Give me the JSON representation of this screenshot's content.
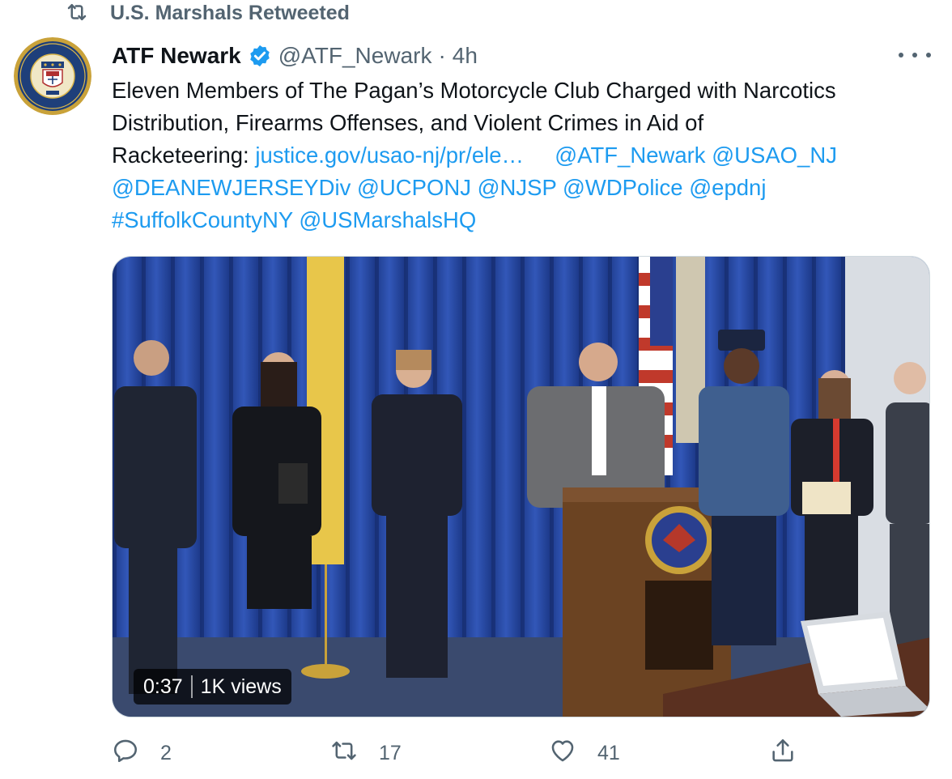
{
  "retweet_context": {
    "label": "U.S. Marshals Retweeted",
    "icon": "retweet-icon"
  },
  "author": {
    "name": "ATF Newark",
    "verified_icon": "verified-badge-icon",
    "handle": "@ATF_Newark",
    "separator": "·",
    "time": "4h",
    "avatar_icon": "atf-seal-avatar"
  },
  "more_icon": "more-options-icon",
  "tweet": {
    "line1": "Eleven Members of The Pagan’s Motorcycle Club Charged with Narcotics",
    "line2": "Distribution, Firearms Offenses, and Violent Crimes in Aid of",
    "line3_prefix": "Racketeering: ",
    "line3_link": "justice.gov/usao-nj/pr/ele…",
    "line3_mentions": [
      "@ATF_Newark",
      "@USAO_NJ"
    ],
    "line4_mentions": [
      "@DEANEWJERSEYDiv",
      "@UCPONJ",
      "@NJSP",
      "@WDPolice",
      "@epdnj"
    ],
    "line5_tags": [
      "#SuffolkCountyNY",
      "@USMarshalsHQ"
    ]
  },
  "video": {
    "duration": "0:37",
    "views": "1K views"
  },
  "actions": {
    "reply": {
      "icon": "reply-icon",
      "count": "2"
    },
    "retweet": {
      "icon": "retweet-icon",
      "count": "17"
    },
    "like": {
      "icon": "heart-icon",
      "count": "41"
    },
    "share": {
      "icon": "share-icon"
    }
  },
  "colors": {
    "link": "#1d9bf0",
    "secondary_text": "#536471",
    "primary_text": "#0f1419",
    "verified": "#1d9bf0"
  }
}
